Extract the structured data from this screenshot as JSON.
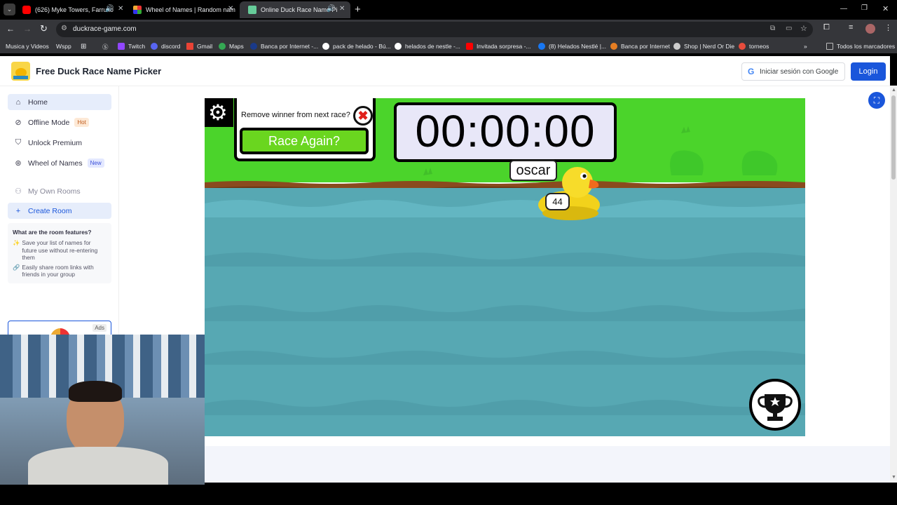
{
  "browser": {
    "tabs": [
      {
        "title": "(626) Myke Towers, Farruko",
        "active": false
      },
      {
        "title": "Wheel of Names | Random nam",
        "active": false
      },
      {
        "title": "Online Duck Race Name Pi",
        "active": true
      }
    ],
    "url": "duckrace-game.com",
    "bookmarks": [
      "Musica y Videos",
      "Wspp",
      "Twitch",
      "discord",
      "Gmail",
      "Maps",
      "Banca por Internet -...",
      "pack de helado - Bú...",
      "helados de nestle -...",
      "Invitada sorpresa -...",
      "(8) Helados Nestlé |...",
      "Banca por Internet",
      "Shop | Nerd Or Die",
      "torneos"
    ],
    "all_bookmarks": "Todos los marcadores"
  },
  "site": {
    "title": "Free Duck Race Name Picker",
    "google_login": "Iniciar sesión con Google",
    "login": "Login"
  },
  "sidebar": {
    "items": [
      {
        "label": "Home",
        "icon": "home-icon"
      },
      {
        "label": "Offline Mode",
        "icon": "wifi-off-icon",
        "badge": "Hot"
      },
      {
        "label": "Unlock Premium",
        "icon": "shield-icon"
      },
      {
        "label": "Wheel of Names",
        "icon": "wheel-icon",
        "badge": "New"
      }
    ],
    "my_rooms": "My Own Rooms",
    "create_room": "Create Room",
    "features_title": "What are the room features?",
    "feature1": "Save your list of names for future use without re-entering them",
    "feature2": "Easily share room links with friends in your group",
    "ads": "Ads"
  },
  "game": {
    "remove_winner": "Remove winner from next race?",
    "race_again": "Race Again?",
    "timer": "00:00:00",
    "duck_name": "oscar",
    "duck_number": "44"
  },
  "colors": {
    "grass": "#4bd42b",
    "water": "#57a8b3",
    "accent": "#1a56db",
    "race_button": "#6ad61f"
  }
}
